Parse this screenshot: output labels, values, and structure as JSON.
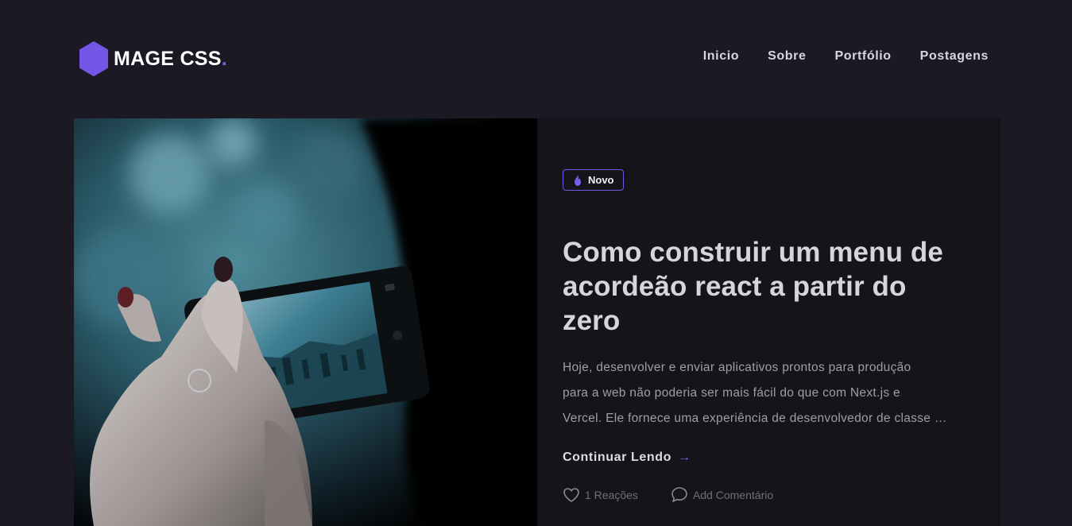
{
  "brand": {
    "name": "MAGE CSS",
    "dot": ".",
    "accent_color": "#7b5cf0"
  },
  "nav": {
    "items": [
      "Inicio",
      "Sobre",
      "Portfólio",
      "Postagens"
    ]
  },
  "post": {
    "badge": {
      "icon": "flame-icon",
      "label": "Novo"
    },
    "title_lines": [
      "Como construir um menu de",
      "acordeão react a partir do",
      "zero"
    ],
    "excerpt_lines": [
      "Hoje, desenvolver e enviar aplicativos prontos para produção",
      "para a web não poderia ser mais fácil do que com Next.js e",
      "Vercel. Ele fornece uma experiência de desenvolvedor de classe mundial"
    ],
    "read_more": "Continuar Lendo",
    "read_more_arrow": "→",
    "reactions": {
      "icon": "heart-icon",
      "label": "1 Reações"
    },
    "comments": {
      "icon": "comment-icon",
      "label": "Add Comentário"
    }
  }
}
